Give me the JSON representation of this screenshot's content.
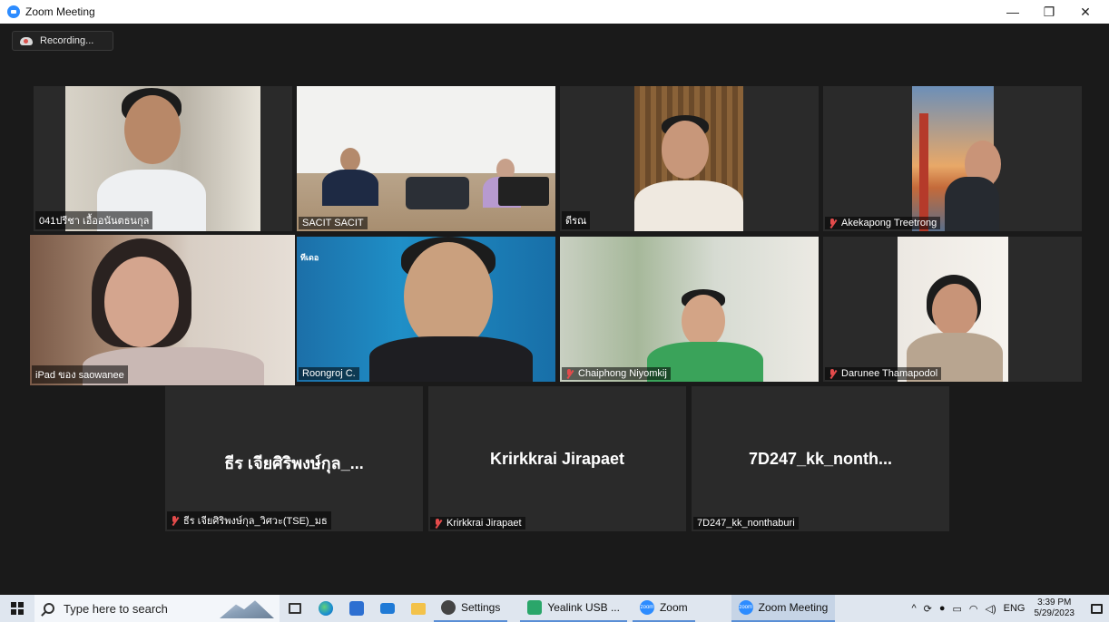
{
  "window": {
    "title": "Zoom Meeting",
    "controls": {
      "minimize": "—",
      "restore": "❐",
      "close": "✕"
    }
  },
  "meeting": {
    "recording_label": "Recording...",
    "tiles": [
      {
        "name": "041ปรีชา เอื้ออนันตธนกุล",
        "muted": false
      },
      {
        "name": "SACIT SACIT",
        "muted": false
      },
      {
        "name": "ดีรณ",
        "muted": false
      },
      {
        "name": "Akekapong Treetrong",
        "muted": true
      },
      {
        "name": "iPad ของ saowanee",
        "muted": false,
        "active_speaker": true
      },
      {
        "name": "Roongroj C.",
        "muted": false,
        "overlay_logo": "ทีเดอ"
      },
      {
        "name": "Chaiphong Niyomkij",
        "muted": true
      },
      {
        "name": "Darunee Thamapodol",
        "muted": true
      }
    ],
    "no_video_tiles": [
      {
        "display_name": "ธีร เจียศิริพงษ์กุล_...",
        "name": "ธีร เจียศิริพงษ์กุล_วิศวะ(TSE)_มธ",
        "muted": true
      },
      {
        "display_name": "Krirkkrai Jirapaet",
        "name": "Krirkkrai Jirapaet",
        "muted": true
      },
      {
        "display_name": "7D247_kk_nonth...",
        "name": "7D247_kk_nonthaburi",
        "muted": false
      }
    ]
  },
  "taskbar": {
    "search_placeholder": "Type here to search",
    "apps": [
      {
        "label": "Settings",
        "icon": "gear-icon"
      },
      {
        "label": "Yealink USB ...",
        "icon": "yealink-icon"
      },
      {
        "label": "Zoom",
        "icon": "zoom-icon"
      },
      {
        "label": "Zoom Meeting",
        "icon": "zoom-icon",
        "active": true
      }
    ],
    "tray": {
      "language": "ENG",
      "time": "3:39 PM",
      "date": "5/29/2023"
    }
  },
  "colors": {
    "meeting_bg": "#1a1a1a",
    "active_speaker_border": "#e5e56a",
    "zoom_blue": "#2d8cff",
    "muted_red": "#e34b4b"
  }
}
